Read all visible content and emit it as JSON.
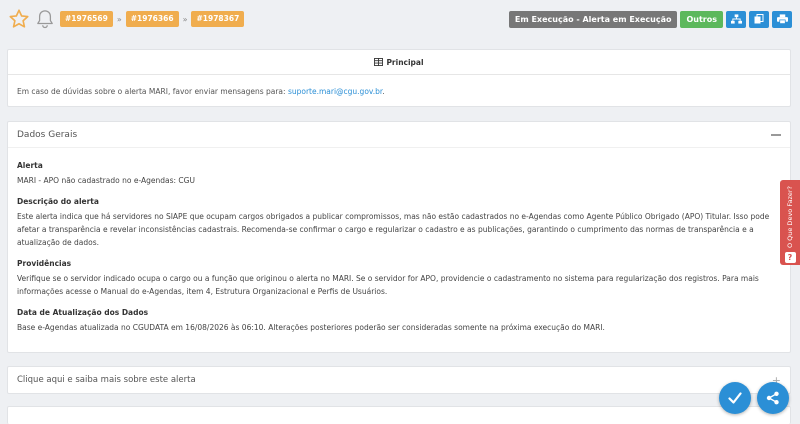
{
  "topbar": {
    "breadcrumbs": [
      "#1976569",
      "#1976366",
      "#1978367"
    ],
    "separator": "»",
    "status": "Em Execução - Alerta em Execução",
    "outros": "Outros"
  },
  "principal": {
    "title": "Principal",
    "info_text": "Em caso de dúvidas sobre o alerta MARI, favor enviar mensagens para: ",
    "email": "suporte.mari@cgu.gov.br",
    "info_end": "."
  },
  "dados_gerais": {
    "title": "Dados Gerais",
    "fields": [
      {
        "label": "Alerta",
        "value": "MARI - APO não cadastrado no e-Agendas: CGU"
      },
      {
        "label": "Descrição do alerta",
        "value": "Este alerta indica que há servidores no SIAPE que ocupam cargos obrigados a publicar compromissos, mas não estão cadastrados no e-Agendas como Agente Público Obrigado (APO) Titular. Isso pode afetar a transparência e revelar inconsistências cadastrais. Recomenda-se confirmar o cargo e regularizar o cadastro e as publicações, garantindo o cumprimento das normas de transparência e a atualização de dados."
      },
      {
        "label": "Providências",
        "value": "Verifique se o servidor indicado ocupa o cargo ou a função que originou o alerta no MARI. Se o servidor for APO, providencie o cadastramento no sistema para regularização dos registros. Para mais informações acesse o Manual do e-Agendas, item 4, Estrutura Organizacional e Perfis de Usuários."
      },
      {
        "label": "Data de Atualização dos Dados",
        "value": "Base e-Agendas atualizada no CGUDATA em 16/08/2026 às 06:10. Alterações posteriores poderão ser consideradas somente na próxima execução do MARI."
      }
    ]
  },
  "saiba_mais": {
    "title": "Clique aqui e saiba mais sobre este alerta",
    "plus": "+"
  },
  "side_tab": {
    "label": "O Que Devo Fazer?",
    "q": "?"
  },
  "colors": {
    "accent": "#2b8fd6",
    "crumb": "#f0ad4e",
    "success": "#5cb85c",
    "danger": "#d9534f",
    "status": "#777777"
  }
}
